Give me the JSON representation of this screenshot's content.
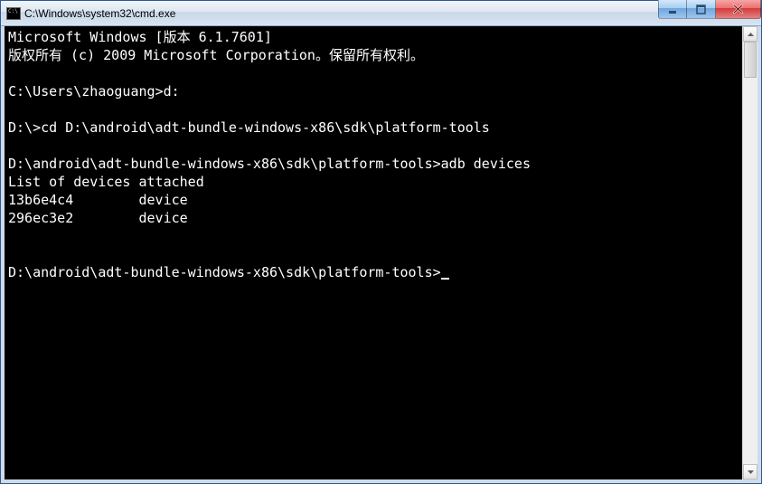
{
  "window": {
    "title": "C:\\Windows\\system32\\cmd.exe"
  },
  "terminal": {
    "header_line1": "Microsoft Windows [版本 6.1.7601]",
    "header_line2": "版权所有 (c) 2009 Microsoft Corporation。保留所有权利。",
    "blank": "",
    "line1_prompt": "C:\\Users\\zhaoguang>",
    "line1_cmd": "d:",
    "line2_prompt": "D:\\>",
    "line2_cmd": "cd D:\\android\\adt-bundle-windows-x86\\sdk\\platform-tools",
    "line3_prompt": "D:\\android\\adt-bundle-windows-x86\\sdk\\platform-tools>",
    "line3_cmd": "adb devices",
    "out_header": "List of devices attached",
    "out_row1": "13b6e4c4        device",
    "out_row2": "296ec3e2        device",
    "line4_prompt": "D:\\android\\adt-bundle-windows-x86\\sdk\\platform-tools>"
  }
}
